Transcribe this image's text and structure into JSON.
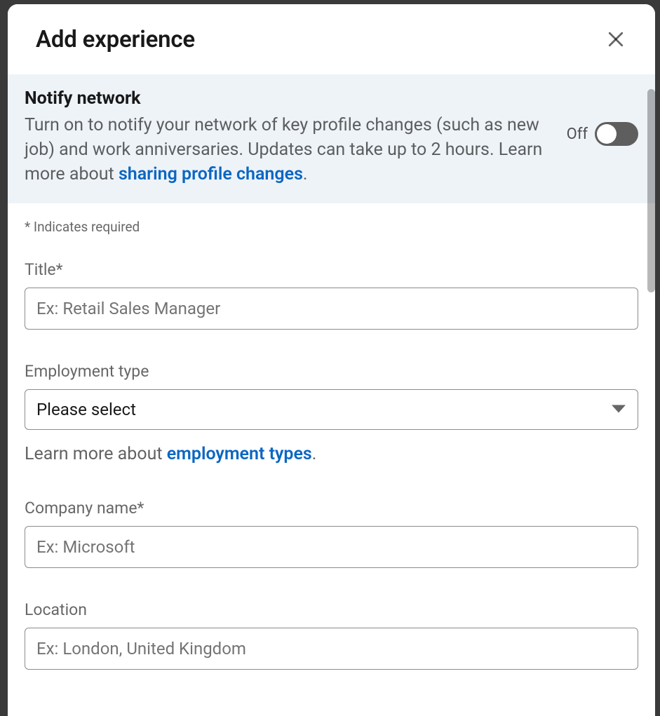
{
  "modal": {
    "title": "Add experience"
  },
  "notify": {
    "title": "Notify network",
    "desc_prefix": "Turn on to notify your network of key profile changes (such as new job) and work anniversaries. Updates can take up to 2 hours. Learn more about ",
    "link_text": "sharing profile changes",
    "desc_suffix": ".",
    "toggle_label": "Off"
  },
  "form": {
    "required_note": "* Indicates required",
    "title_label": "Title*",
    "title_placeholder": "Ex: Retail Sales Manager",
    "employment_label": "Employment type",
    "employment_selected": "Please select",
    "employment_help_prefix": "Learn more about ",
    "employment_help_link": "employment types",
    "employment_help_suffix": ".",
    "company_label": "Company name*",
    "company_placeholder": "Ex: Microsoft",
    "location_label": "Location",
    "location_placeholder": "Ex: London, United Kingdom"
  }
}
